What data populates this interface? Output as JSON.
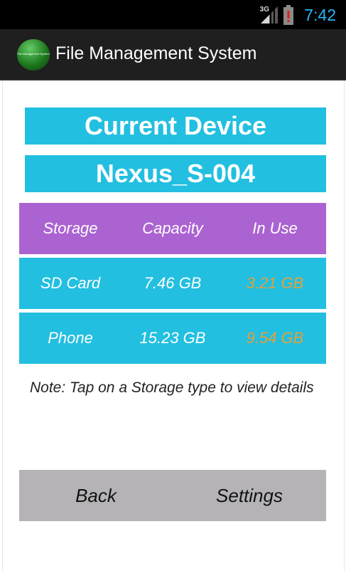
{
  "status_bar": {
    "network": "3G",
    "time": "7:42",
    "time_color": "#29b6f6"
  },
  "action_bar": {
    "app_title": "File Management System",
    "logo_text": "File Management System"
  },
  "header": {
    "title": "Current Device",
    "device_name": "Nexus_S-004",
    "color": "#22bfe0"
  },
  "table": {
    "columns": [
      "Storage",
      "Capacity",
      "In Use"
    ],
    "header_color": "#ab63d1",
    "rows": [
      {
        "storage": "SD Card",
        "capacity": "7.46 GB",
        "in_use": "3.21 GB"
      },
      {
        "storage": "Phone",
        "capacity": "15.23 GB",
        "in_use": "9.54 GB"
      }
    ],
    "in_use_color": "#e3a13a"
  },
  "note": "Note: Tap on a Storage type to view details",
  "buttons": {
    "back": "Back",
    "settings": "Settings"
  }
}
